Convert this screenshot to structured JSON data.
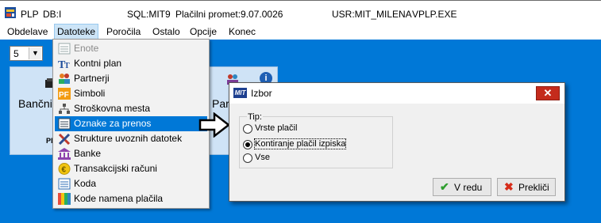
{
  "titlebar": {
    "app": "PLP",
    "db": "DB:I",
    "sql": "SQL:MIT9",
    "promet": "Plačilni promet:9.07.0026",
    "user": "USR:MIT_MILENA",
    "exe": "VPLP.EXE"
  },
  "menu": [
    {
      "label": "Obdelave"
    },
    {
      "label": "Datoteke"
    },
    {
      "label": "Poročila"
    },
    {
      "label": "Ostalo"
    },
    {
      "label": "Opcije"
    },
    {
      "label": "Konec"
    }
  ],
  "combo": {
    "value": "5"
  },
  "tiles": {
    "left_label": "Bančni",
    "left_small": "Pl",
    "right_label": "Par"
  },
  "dropdown": [
    {
      "label": "Enote",
      "icon": "list-icon",
      "disabled": true
    },
    {
      "label": "Kontni plan",
      "icon": "text-tt-icon"
    },
    {
      "label": "Partnerji",
      "icon": "people-icon"
    },
    {
      "label": "Simboli",
      "icon": "pf-icon"
    },
    {
      "label": "Stroškovna mesta",
      "icon": "hierarchy-icon"
    },
    {
      "label": "Oznake za prenos",
      "icon": "list-icon",
      "selected": true
    },
    {
      "label": "Strukture uvoznih datotek",
      "icon": "tools-icon"
    },
    {
      "label": "Banke",
      "icon": "bank-icon"
    },
    {
      "label": "Transakcijski računi",
      "icon": "coin-icon"
    },
    {
      "label": "Koda",
      "icon": "list-icon"
    },
    {
      "label": "Kode namena plačila",
      "icon": "colorbars-icon"
    }
  ],
  "dialog": {
    "title": "Izbor",
    "group_label": "Tip:",
    "options": [
      {
        "label": "Vrste plačil",
        "checked": false
      },
      {
        "label": "Kontiranje plačil izpiska",
        "checked": true
      },
      {
        "label": "Vse",
        "checked": false
      }
    ],
    "ok_label": "V redu",
    "cancel_label": "Prekliči"
  },
  "colors": {
    "workspace": "#0078d7",
    "selection": "#0078d7",
    "menu_active": "#cce4f7",
    "close": "#c42b1c"
  }
}
